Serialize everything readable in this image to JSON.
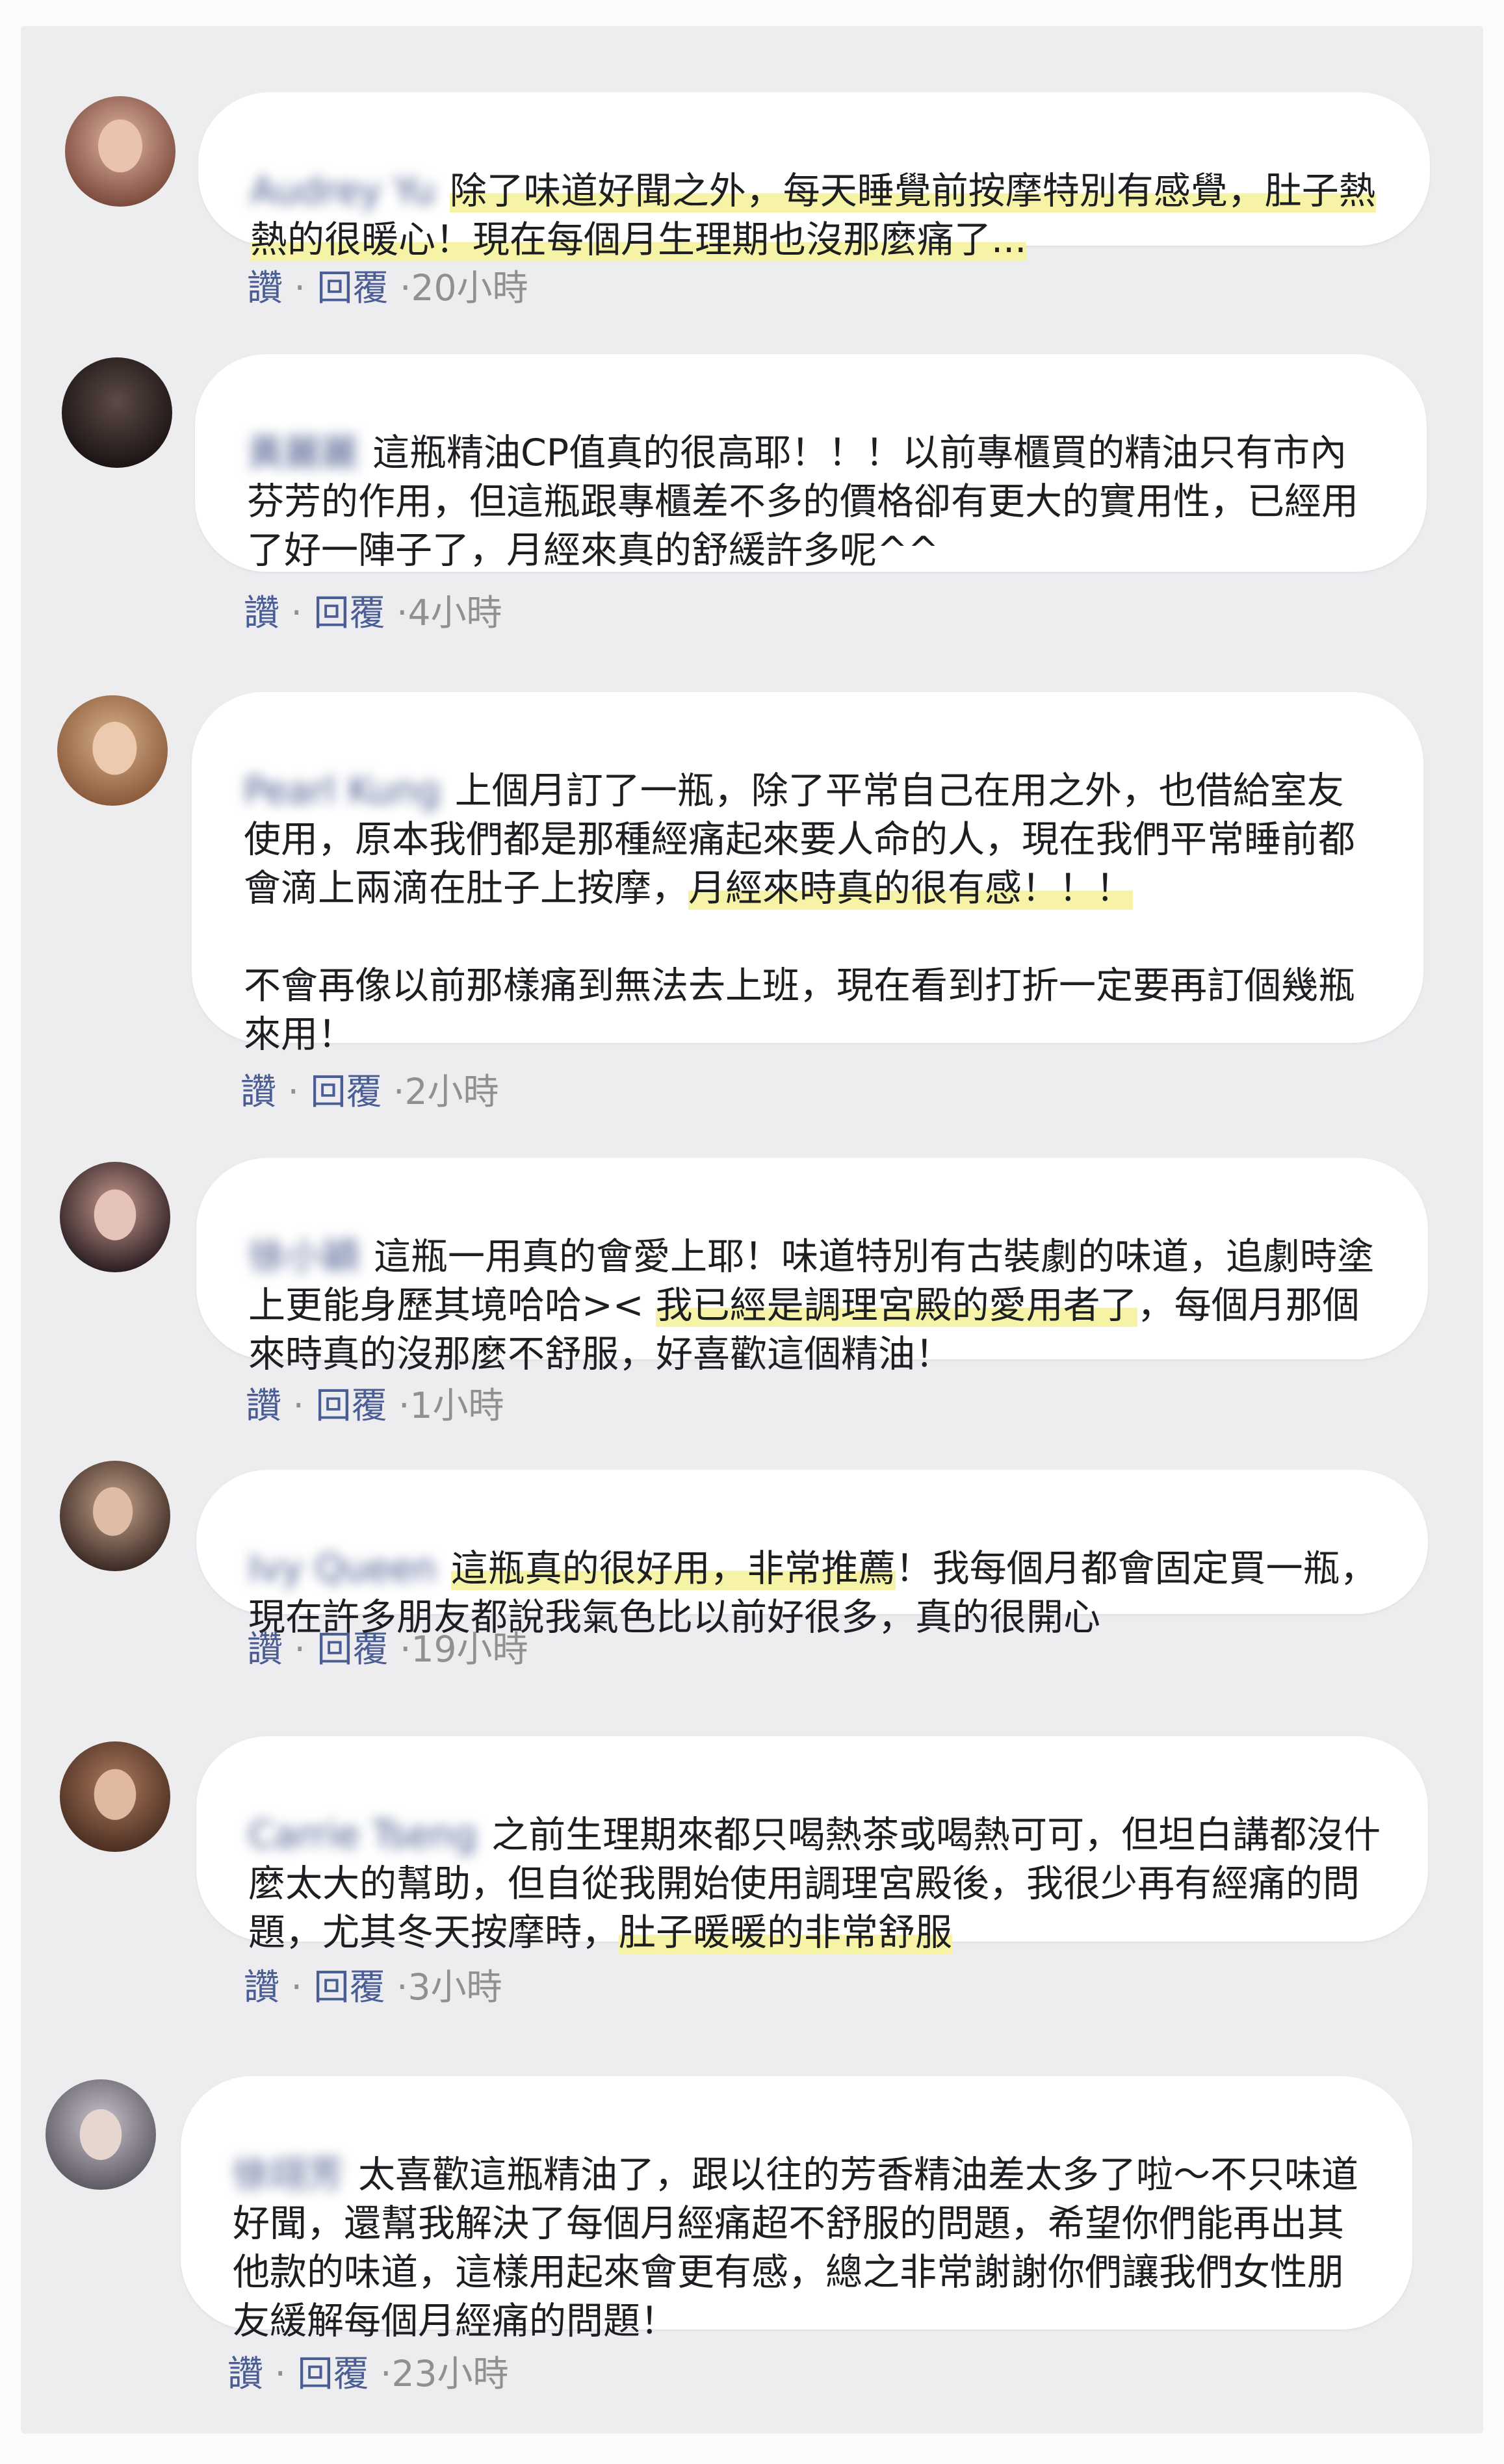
{
  "comments": [
    {
      "name": "Audrey Yu",
      "avatar_colors": [
        "#7a4a3c",
        "#e4b7a5"
      ],
      "text_pre": "",
      "text_hl": "除了味道好聞之外，每天睡覺前按摩特別有感覺，肚子熱熱的很暖心！現在每個月生理期也沒那麼痛了...",
      "text_post": "",
      "time": "20小時"
    },
    {
      "name": "黃麗麗",
      "avatar_colors": [
        "#1b1414",
        "#5c4a45"
      ],
      "text_pre": "這瓶精油CP值真的很高耶！！！以前專櫃買的精油只有市內芬芳的作用，但這瓶跟專櫃差不多的價格卻有更大的實用性，已經用了好一陣子了，月經來真的舒緩許多呢^^",
      "text_hl": "",
      "text_post": "",
      "time": "4小時"
    },
    {
      "name": "Pearl Kung",
      "avatar_colors": [
        "#8a5a3a",
        "#d9b18a"
      ],
      "text_pre": "上個月訂了一瓶，除了平常自己在用之外，也借給室友使用，原本我們都是那種經痛起來要人命的人，現在我們平常睡前都會滴上兩滴在肚子上按摩，",
      "text_hl": "月經來時真的很有感！！！",
      "text_post": "\n\n不會再像以前那樣痛到無法去上班，現在看到打折一定要再訂個幾瓶來用！",
      "time": "2小時"
    },
    {
      "name": "徐小穎",
      "avatar_colors": [
        "#2a1e22",
        "#c99a8e"
      ],
      "text_pre": "這瓶一用真的會愛上耶！味道特別有古裝劇的味道，追劇時塗上更能身歷其境哈哈>< ",
      "text_hl": "我已經是調理宮殿的愛用者了",
      "text_post": "，每個月那個來時真的沒那麼不舒服，好喜歡這個精油！",
      "time": "1小時"
    },
    {
      "name": "Ivy Queen",
      "avatar_colors": [
        "#3b2a24",
        "#c8a48c"
      ],
      "text_pre": "",
      "text_hl": "這瓶真的很好用，非常推薦",
      "text_post": "！我每個月都會固定買一瓶，現在許多朋友都說我氣色比以前好很多，真的很開心",
      "time": "19小時"
    },
    {
      "name": "Carrie Tseng",
      "avatar_colors": [
        "#4a2f22",
        "#b07a5e"
      ],
      "text_pre": "之前生理期來都只喝熱茶或喝熱可可，但坦白講都沒什麼太大的幫助，但自從我開始使用調理宮殿後，我很少再有經痛的問題，尤其冬天按摩時，",
      "text_hl": "肚子暖暖的非常舒服",
      "text_post": "",
      "time": "3小時"
    },
    {
      "name": "徐翊芳",
      "avatar_colors": [
        "#5e5a63",
        "#c9c4cd"
      ],
      "text_pre": "太喜歡這瓶精油了，跟以往的芳香精油差太多了啦～不只味道好聞，還幫我解決了每個月經痛超不舒服的問題，希望你們能再出其他款的味道，這樣用起來會更有感，總之非常謝謝你們讓我們女性朋友緩解每個月經痛的問題！",
      "text_hl": "",
      "text_post": "",
      "time": "23小時"
    }
  ],
  "actions": {
    "like_label": "讚",
    "reply_label": "回覆",
    "separator": "·"
  },
  "colors": {
    "link": "#4a5d95",
    "highlight": "#f6f3a7",
    "bubble": "#ffffff",
    "background": "#ededf0"
  }
}
